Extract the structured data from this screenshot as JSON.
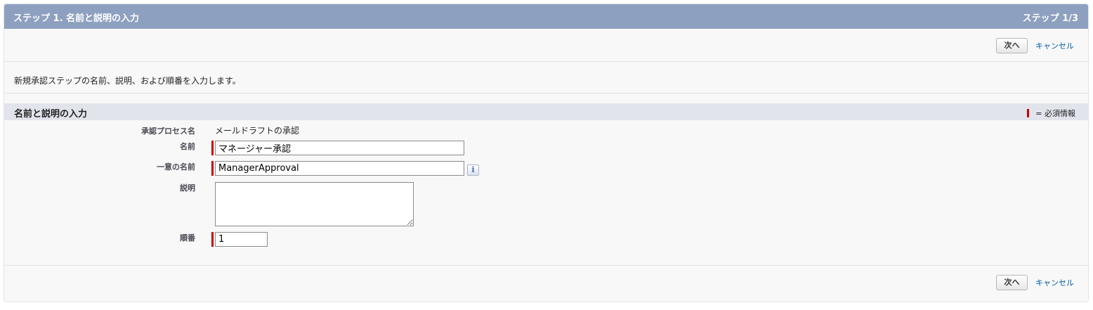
{
  "header": {
    "title": "ステップ 1. 名前と説明の入力",
    "step": "ステップ 1/3"
  },
  "buttons": {
    "next": "次へ",
    "cancel": "キャンセル"
  },
  "description": "新規承認ステップの名前、説明、および順番を入力します。",
  "section": {
    "title": "名前と説明の入力",
    "required_legend": "= 必須情報"
  },
  "form": {
    "process_name_label": "承認プロセス名",
    "process_name_value": "メールドラフトの承認",
    "name_label": "名前",
    "name_value": "マネージャー承認",
    "unique_name_label": "一意の名前",
    "unique_name_value": "ManagerApproval",
    "description_label": "説明",
    "description_value": "",
    "order_label": "順番",
    "order_value": "1",
    "info_icon_glyph": "i"
  },
  "colors": {
    "header_bg": "#8ea0c0",
    "section_bg": "#e2e4ec",
    "required": "#cc0000",
    "link": "#015ba7"
  }
}
